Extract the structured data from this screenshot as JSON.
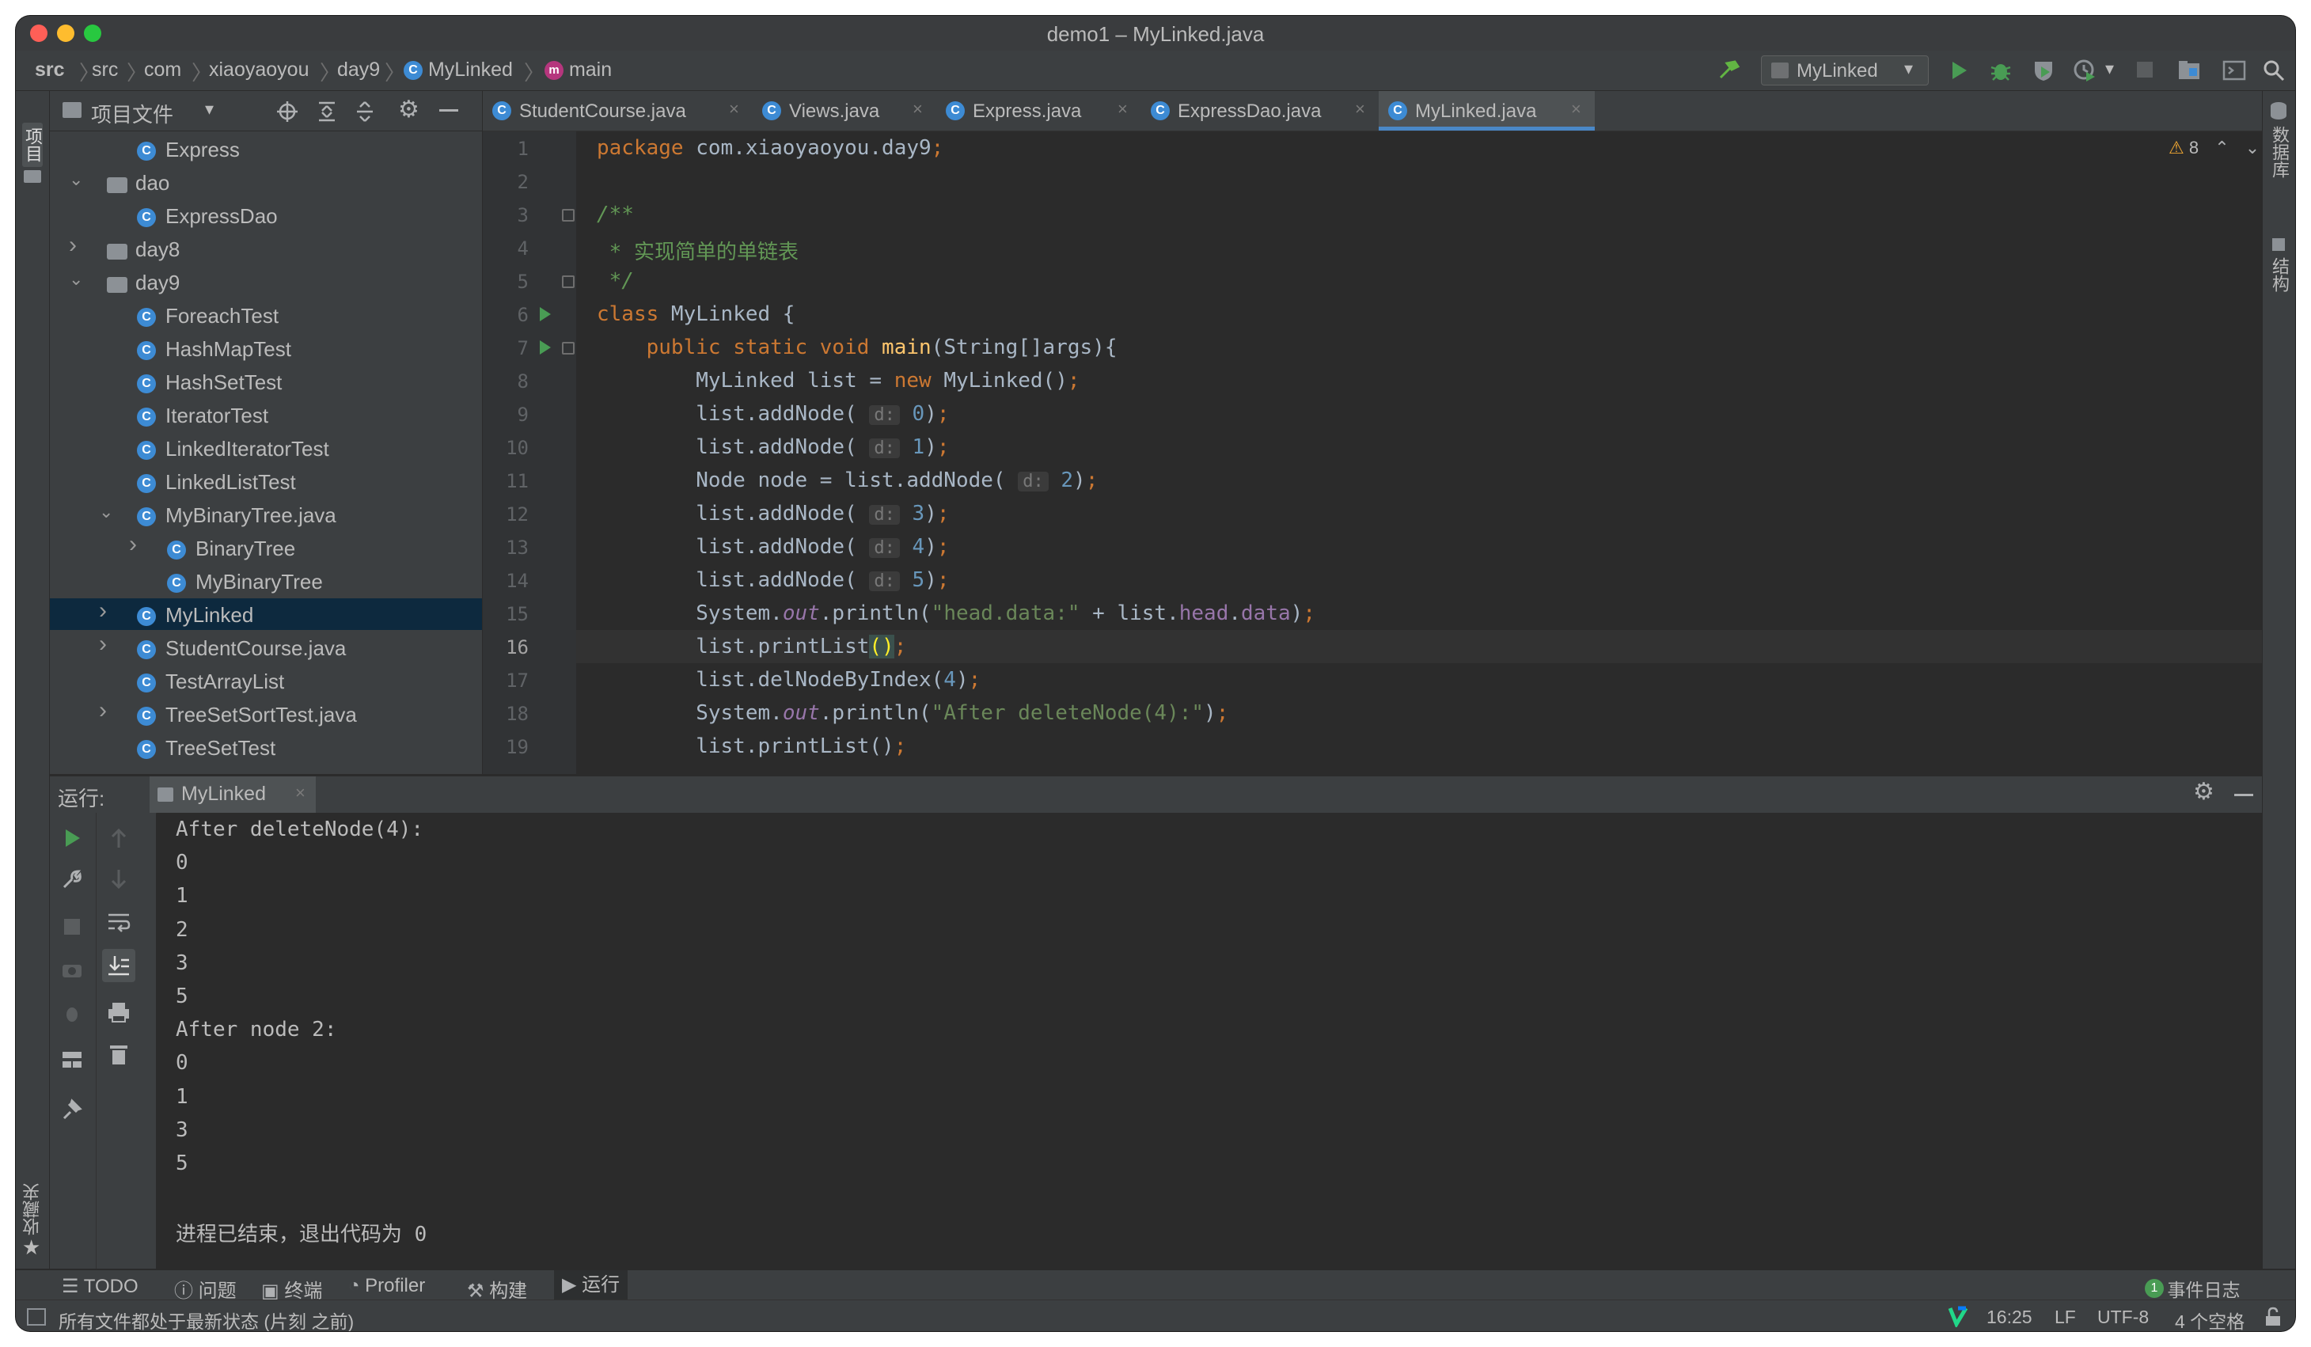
{
  "window": {
    "title": "demo1 – MyLinked.java"
  },
  "breadcrumb": [
    "src",
    "src",
    "com",
    "xiaoyaoyou",
    "day9",
    "MyLinked",
    "main"
  ],
  "run_config": {
    "label": "MyLinked"
  },
  "project_panel": {
    "title": "项目文件"
  },
  "project_tree": [
    {
      "label": "Express",
      "type": "class",
      "depth": 3,
      "expand": ""
    },
    {
      "label": "dao",
      "type": "folder",
      "depth": 2,
      "expand": "open"
    },
    {
      "label": "ExpressDao",
      "type": "class",
      "depth": 3,
      "expand": ""
    },
    {
      "label": "day8",
      "type": "folder",
      "depth": 2,
      "expand": "closed"
    },
    {
      "label": "day9",
      "type": "folder",
      "depth": 2,
      "expand": "open"
    },
    {
      "label": "ForeachTest",
      "type": "class",
      "depth": 3,
      "expand": ""
    },
    {
      "label": "HashMapTest",
      "type": "class",
      "depth": 3,
      "expand": ""
    },
    {
      "label": "HashSetTest",
      "type": "class",
      "depth": 3,
      "expand": ""
    },
    {
      "label": "IteratorTest",
      "type": "class",
      "depth": 3,
      "expand": ""
    },
    {
      "label": "LinkedIteratorTest",
      "type": "class",
      "depth": 3,
      "expand": ""
    },
    {
      "label": "LinkedListTest",
      "type": "class",
      "depth": 3,
      "expand": ""
    },
    {
      "label": "MyBinaryTree.java",
      "type": "class",
      "depth": 3,
      "expand": "open"
    },
    {
      "label": "BinaryTree",
      "type": "class",
      "depth": 4,
      "expand": "closed"
    },
    {
      "label": "MyBinaryTree",
      "type": "class",
      "depth": 4,
      "expand": ""
    },
    {
      "label": "MyLinked",
      "type": "class",
      "depth": 3,
      "expand": "closed",
      "selected": true
    },
    {
      "label": "StudentCourse.java",
      "type": "class",
      "depth": 3,
      "expand": "closed"
    },
    {
      "label": "TestArrayList",
      "type": "class",
      "depth": 3,
      "expand": ""
    },
    {
      "label": "TreeSetSortTest.java",
      "type": "class",
      "depth": 3,
      "expand": "closed"
    },
    {
      "label": "TreeSetTest",
      "type": "class",
      "depth": 3,
      "expand": ""
    }
  ],
  "tabs": [
    {
      "label": "StudentCourse.java",
      "active": false
    },
    {
      "label": "Views.java",
      "active": false
    },
    {
      "label": "Express.java",
      "active": false
    },
    {
      "label": "ExpressDao.java",
      "active": false
    },
    {
      "label": "MyLinked.java",
      "active": true
    }
  ],
  "inspection": {
    "warnings": "8"
  },
  "editor": {
    "current_line": 16,
    "lines": [
      [
        [
          "kw",
          "package "
        ],
        [
          "p",
          "com.xiaoyaoyou.day9"
        ],
        [
          "kw",
          ";"
        ]
      ],
      [],
      [
        [
          "cm",
          "/**"
        ]
      ],
      [
        [
          "cm",
          " * "
        ],
        [
          "cmzh",
          "实现简单的单链表"
        ]
      ],
      [
        [
          "cm",
          " */"
        ]
      ],
      [
        [
          "kw",
          "class "
        ],
        [
          "p",
          "MyLinked {"
        ]
      ],
      [
        [
          "p",
          "    "
        ],
        [
          "kw",
          "public static void "
        ],
        [
          "fn",
          "main"
        ],
        [
          "p",
          "(String[]args){"
        ]
      ],
      [
        [
          "p",
          "        MyLinked list = "
        ],
        [
          "kw",
          "new "
        ],
        [
          "p",
          "MyLinked()"
        ],
        [
          "kw",
          ";"
        ]
      ],
      [
        [
          "p",
          "        list.addNode( "
        ],
        [
          "hint",
          "d:"
        ],
        [
          "p",
          " "
        ],
        [
          "nm",
          "0"
        ],
        [
          "p",
          ")"
        ],
        [
          "kw",
          ";"
        ]
      ],
      [
        [
          "p",
          "        list.addNode( "
        ],
        [
          "hint",
          "d:"
        ],
        [
          "p",
          " "
        ],
        [
          "nm",
          "1"
        ],
        [
          "p",
          ")"
        ],
        [
          "kw",
          ";"
        ]
      ],
      [
        [
          "p",
          "        Node node = list.addNode( "
        ],
        [
          "hint",
          "d:"
        ],
        [
          "p",
          " "
        ],
        [
          "nm",
          "2"
        ],
        [
          "p",
          ")"
        ],
        [
          "kw",
          ";"
        ]
      ],
      [
        [
          "p",
          "        list.addNode( "
        ],
        [
          "hint",
          "d:"
        ],
        [
          "p",
          " "
        ],
        [
          "nm",
          "3"
        ],
        [
          "p",
          ")"
        ],
        [
          "kw",
          ";"
        ]
      ],
      [
        [
          "p",
          "        list.addNode( "
        ],
        [
          "hint",
          "d:"
        ],
        [
          "p",
          " "
        ],
        [
          "nm",
          "4"
        ],
        [
          "p",
          ")"
        ],
        [
          "kw",
          ";"
        ]
      ],
      [
        [
          "p",
          "        list.addNode( "
        ],
        [
          "hint",
          "d:"
        ],
        [
          "p",
          " "
        ],
        [
          "nm",
          "5"
        ],
        [
          "p",
          ")"
        ],
        [
          "kw",
          ";"
        ]
      ],
      [
        [
          "p",
          "        System."
        ],
        [
          "sfld",
          "out"
        ],
        [
          "p",
          ".println("
        ],
        [
          "st",
          "\"head.data:\""
        ],
        [
          "p",
          " + list."
        ],
        [
          "fld",
          "head"
        ],
        [
          "p",
          "."
        ],
        [
          "fld",
          "data"
        ],
        [
          "p",
          ")"
        ],
        [
          "kw",
          ";"
        ]
      ],
      [
        [
          "p",
          "        list.printList"
        ],
        [
          "brace",
          "()"
        ],
        [
          "kw",
          ";"
        ]
      ],
      [
        [
          "p",
          "        list.delNodeByIndex("
        ],
        [
          "nm",
          "4"
        ],
        [
          "p",
          ")"
        ],
        [
          "kw",
          ";"
        ]
      ],
      [
        [
          "p",
          "        System."
        ],
        [
          "sfld",
          "out"
        ],
        [
          "p",
          ".println("
        ],
        [
          "st",
          "\"After deleteNode(4):\""
        ],
        [
          "p",
          ")"
        ],
        [
          "kw",
          ";"
        ]
      ],
      [
        [
          "p",
          "        list.printList()"
        ],
        [
          "kw",
          ";"
        ]
      ]
    ]
  },
  "run_panel": {
    "label": "运行:",
    "tab": "MyLinked",
    "output": [
      "After deleteNode(4):",
      "0",
      "1",
      "2",
      "3",
      "5",
      "After node 2:",
      "0",
      "1",
      "3",
      "5",
      "",
      "进程已结束，退出代码为 0"
    ]
  },
  "left_strip": {
    "project": "项目",
    "favorites": "收藏夹"
  },
  "right_strip": {
    "database": "数据库",
    "structure": "结构"
  },
  "bottom_tools": [
    {
      "label": "TODO",
      "icon": "list-icon"
    },
    {
      "label": "问题",
      "icon": "info-icon"
    },
    {
      "label": "终端",
      "icon": "terminal-icon"
    },
    {
      "label": "Profiler",
      "icon": "profiler-icon"
    },
    {
      "label": "构建",
      "icon": "hammer-icon"
    },
    {
      "label": "运行",
      "icon": "play-icon"
    }
  ],
  "event_log": {
    "label": "事件日志",
    "count": "1"
  },
  "status": {
    "message": "所有文件都处于最新状态 (片刻 之前)",
    "position": "16:25",
    "line_sep": "LF",
    "encoding": "UTF-8",
    "indent": "4 个空格"
  },
  "colors": {
    "accent": "#4a88c7",
    "run": "#499c54",
    "selection": "#0d293e"
  }
}
